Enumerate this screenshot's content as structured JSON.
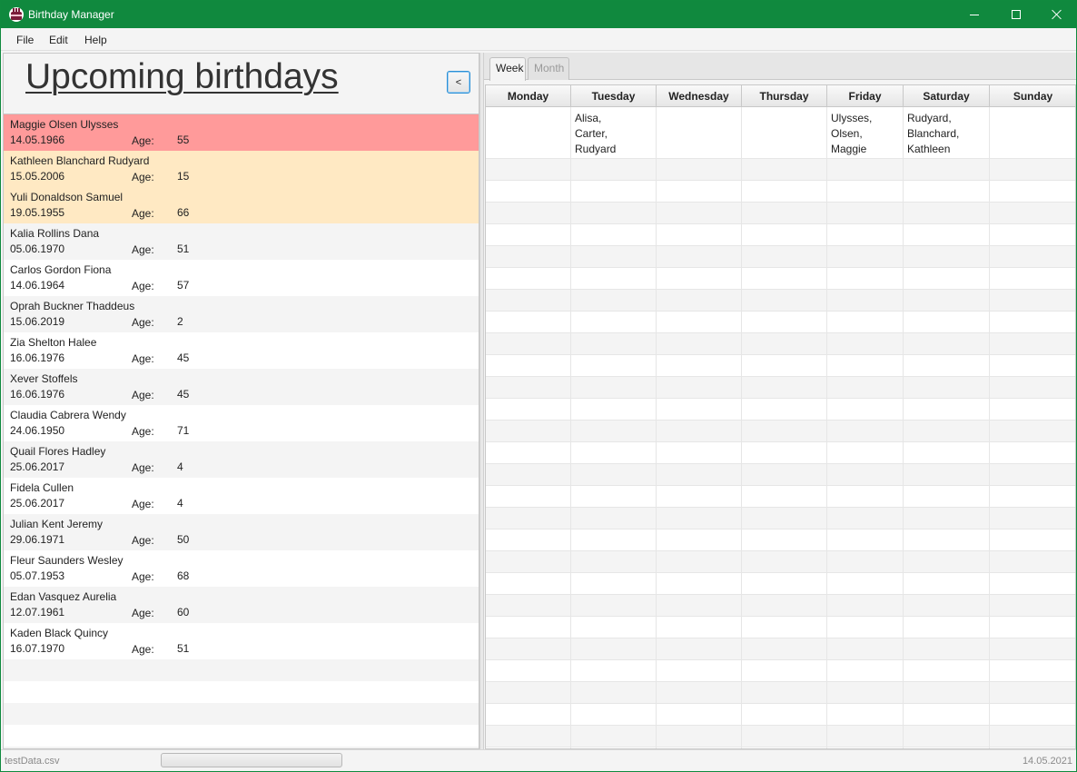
{
  "window": {
    "title": "Birthday Manager",
    "accent": "#10893e"
  },
  "menu": {
    "file": "File",
    "edit": "Edit",
    "help": "Help"
  },
  "heading": "Upcoming birthdays",
  "collapse_label": "<",
  "age_label": "Age:",
  "highlight_colors": {
    "today": "#ff9a9a",
    "this_week": "#ffe9c3"
  },
  "birthdays": [
    {
      "name": "Maggie Olsen Ulysses",
      "date": "14.05.1966",
      "age": "55",
      "highlight": "today"
    },
    {
      "name": "Kathleen Blanchard Rudyard",
      "date": "15.05.2006",
      "age": "15",
      "highlight": "this_week"
    },
    {
      "name": "Yuli Donaldson Samuel",
      "date": "19.05.1955",
      "age": "66",
      "highlight": "this_week"
    },
    {
      "name": "Kalia Rollins Dana",
      "date": "05.06.1970",
      "age": "51",
      "highlight": ""
    },
    {
      "name": "Carlos Gordon Fiona",
      "date": "14.06.1964",
      "age": "57",
      "highlight": ""
    },
    {
      "name": "Oprah Buckner Thaddeus",
      "date": "15.06.2019",
      "age": "2",
      "highlight": ""
    },
    {
      "name": "Zia Shelton Halee",
      "date": "16.06.1976",
      "age": "45",
      "highlight": ""
    },
    {
      "name": "Xever Stoffels",
      "date": "16.06.1976",
      "age": "45",
      "highlight": ""
    },
    {
      "name": "Claudia Cabrera Wendy",
      "date": "24.06.1950",
      "age": "71",
      "highlight": ""
    },
    {
      "name": "Quail Flores Hadley",
      "date": "25.06.2017",
      "age": "4",
      "highlight": ""
    },
    {
      "name": "Fidela Cullen",
      "date": "25.06.2017",
      "age": "4",
      "highlight": ""
    },
    {
      "name": "Julian Kent Jeremy",
      "date": "29.06.1971",
      "age": "50",
      "highlight": ""
    },
    {
      "name": "Fleur Saunders Wesley",
      "date": "05.07.1953",
      "age": "68",
      "highlight": ""
    },
    {
      "name": "Edan Vasquez Aurelia",
      "date": "12.07.1961",
      "age": "60",
      "highlight": ""
    },
    {
      "name": "Kaden Black Quincy",
      "date": "16.07.1970",
      "age": "51",
      "highlight": ""
    }
  ],
  "tabs": {
    "week": "Week",
    "month": "Month",
    "selected": "Week"
  },
  "calendar": {
    "days": [
      "Monday",
      "Tuesday",
      "Wednesday",
      "Thursday",
      "Friday",
      "Saturday",
      "Sunday"
    ],
    "entries": {
      "Monday": [],
      "Tuesday": [
        "Alisa,",
        "Carter,",
        "Rudyard"
      ],
      "Wednesday": [],
      "Thursday": [],
      "Friday": [
        "Ulysses,",
        "Olsen,",
        "Maggie"
      ],
      "Saturday": [
        "Rudyard,",
        "Blanchard,",
        "Kathleen"
      ],
      "Sunday": []
    }
  },
  "status": {
    "file": "testData.csv",
    "date": "14.05.2021"
  }
}
